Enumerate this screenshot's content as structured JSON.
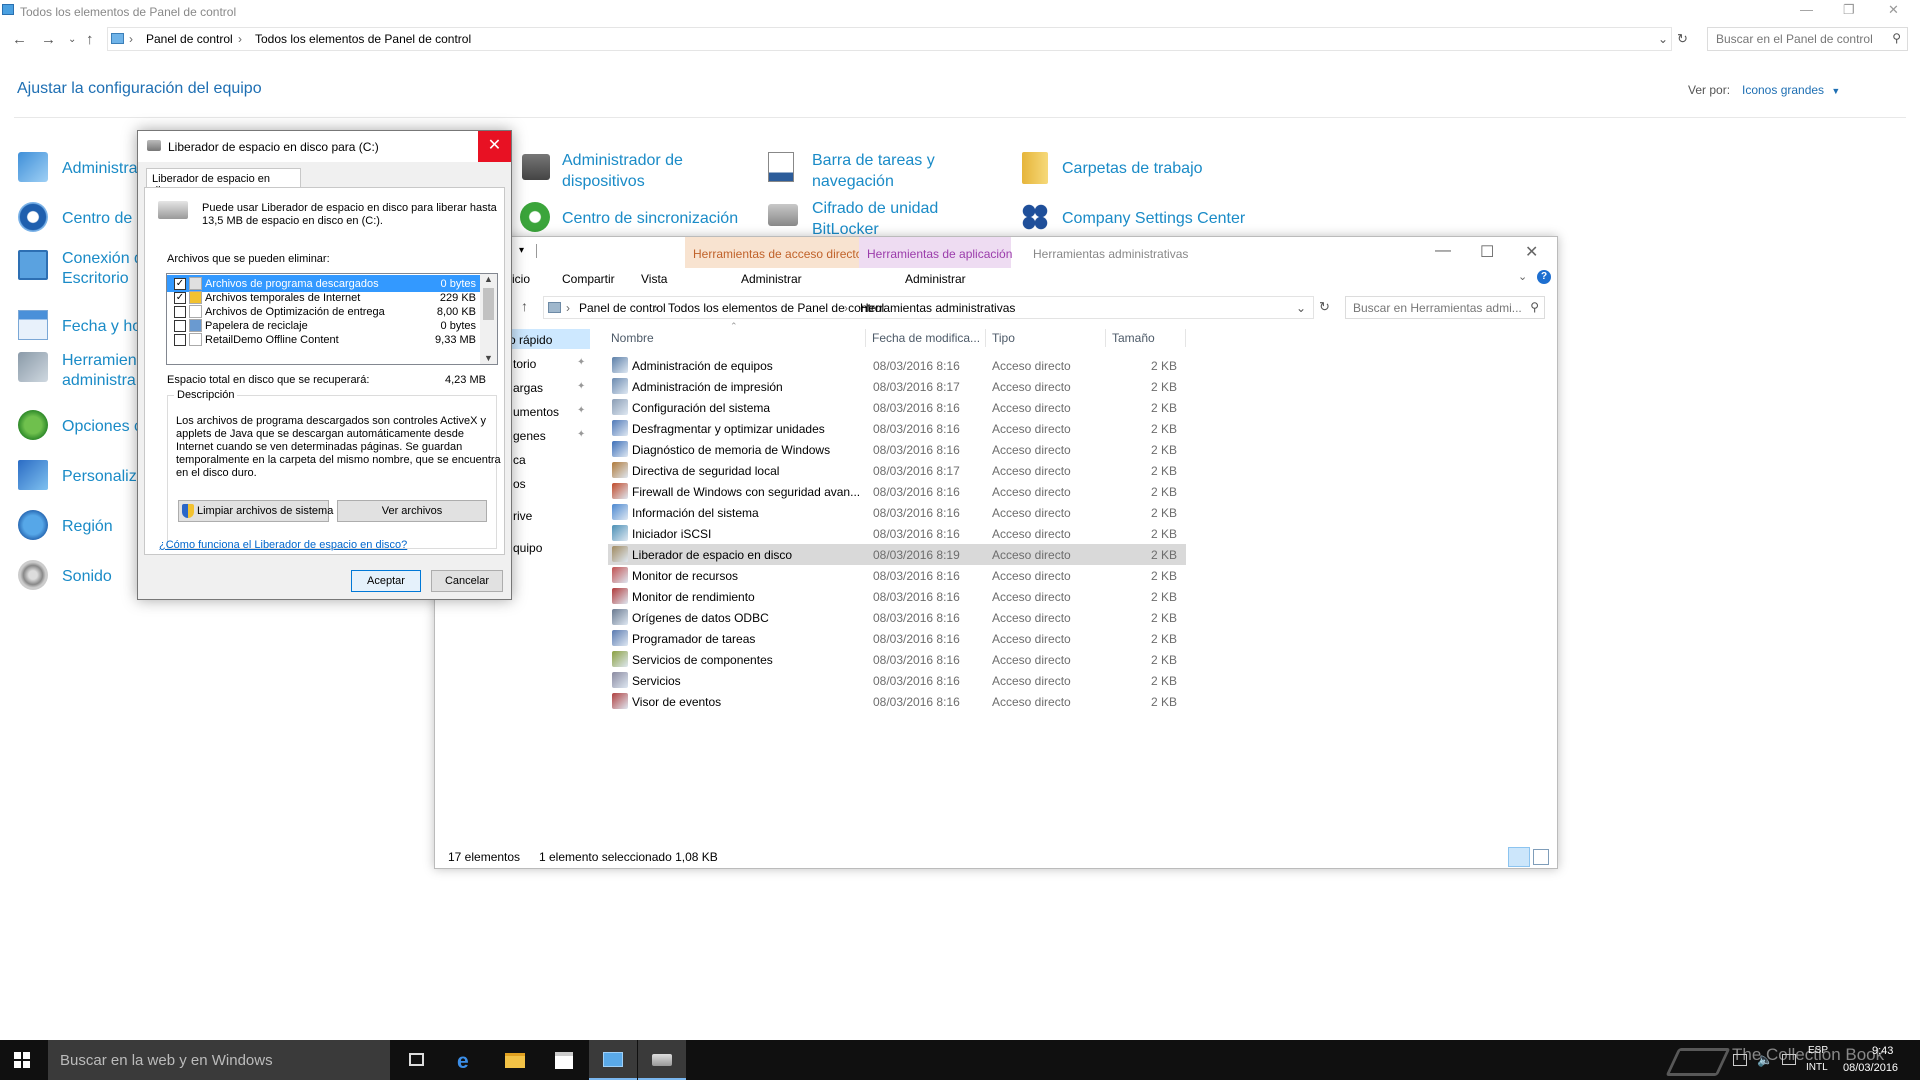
{
  "control_panel": {
    "window_title": "Todos los elementos de Panel de control",
    "breadcrumb": [
      "Panel de control",
      "Todos los elementos de Panel de control"
    ],
    "search_placeholder": "Buscar en el Panel de control",
    "heading": "Ajustar la configuración del equipo",
    "view_by_label": "Ver por:",
    "view_by_value": "Iconos grandes",
    "items_col1": [
      {
        "line1": "Administra",
        "line2": ""
      },
      {
        "line1": "Centro de a",
        "line2": ""
      },
      {
        "line1": "Conexión d",
        "line2": "Escritorio"
      },
      {
        "line1": "Fecha y ho",
        "line2": ""
      },
      {
        "line1": "Herramien",
        "line2": "administra"
      },
      {
        "line1": "Opciones c",
        "line2": ""
      },
      {
        "line1": "Personaliza",
        "line2": ""
      },
      {
        "line1": "Región",
        "line2": ""
      },
      {
        "line1": "Sonido",
        "line2": ""
      }
    ],
    "items_col2": [
      {
        "line1": "Administrador de",
        "line2": "dispositivos"
      },
      {
        "line1": "Centro de sincronización",
        "line2": ""
      }
    ],
    "items_col3": [
      {
        "line1": "Barra de tareas y",
        "line2": "navegación"
      },
      {
        "line1": "Cifrado de unidad",
        "line2": "BitLocker"
      }
    ],
    "items_col4": [
      {
        "line1": "Carpetas de trabajo",
        "line2": ""
      },
      {
        "line1": "Company Settings Center",
        "line2": ""
      }
    ]
  },
  "explorer": {
    "context_tabs": [
      "Herramientas de acceso directo",
      "Herramientas de aplicación"
    ],
    "window_title": "Herramientas administrativas",
    "ribbon": {
      "inicio": "icio",
      "compartir": "Compartir",
      "vista": "Vista",
      "administrar1": "Administrar",
      "administrar2": "Administrar"
    },
    "breadcrumb": [
      "Panel de control",
      "Todos los elementos de Panel de control",
      "Herramientas administrativas"
    ],
    "search_placeholder": "Buscar en Herramientas admi...",
    "nav": [
      "o rápido",
      "torio",
      "argas",
      "umentos",
      "genes",
      "ca",
      "os",
      "rive",
      "quipo"
    ],
    "columns": [
      "Nombre",
      "Fecha de modifica...",
      "Tipo",
      "Tamaño"
    ],
    "files": [
      {
        "name": "Administración de equipos",
        "date": "08/03/2016 8:16",
        "type": "Acceso directo",
        "size": "2 KB"
      },
      {
        "name": "Administración de impresión",
        "date": "08/03/2016 8:17",
        "type": "Acceso directo",
        "size": "2 KB"
      },
      {
        "name": "Configuración del sistema",
        "date": "08/03/2016 8:16",
        "type": "Acceso directo",
        "size": "2 KB"
      },
      {
        "name": "Desfragmentar y optimizar unidades",
        "date": "08/03/2016 8:16",
        "type": "Acceso directo",
        "size": "2 KB"
      },
      {
        "name": "Diagnóstico de memoria de Windows",
        "date": "08/03/2016 8:16",
        "type": "Acceso directo",
        "size": "2 KB"
      },
      {
        "name": "Directiva de seguridad local",
        "date": "08/03/2016 8:17",
        "type": "Acceso directo",
        "size": "2 KB"
      },
      {
        "name": "Firewall de Windows con seguridad avan...",
        "date": "08/03/2016 8:16",
        "type": "Acceso directo",
        "size": "2 KB"
      },
      {
        "name": "Información del sistema",
        "date": "08/03/2016 8:16",
        "type": "Acceso directo",
        "size": "2 KB"
      },
      {
        "name": "Iniciador iSCSI",
        "date": "08/03/2016 8:16",
        "type": "Acceso directo",
        "size": "2 KB"
      },
      {
        "name": "Liberador de espacio en disco",
        "date": "08/03/2016 8:19",
        "type": "Acceso directo",
        "size": "2 KB"
      },
      {
        "name": "Monitor de recursos",
        "date": "08/03/2016 8:16",
        "type": "Acceso directo",
        "size": "2 KB"
      },
      {
        "name": "Monitor de rendimiento",
        "date": "08/03/2016 8:16",
        "type": "Acceso directo",
        "size": "2 KB"
      },
      {
        "name": "Orígenes de datos ODBC",
        "date": "08/03/2016 8:16",
        "type": "Acceso directo",
        "size": "2 KB"
      },
      {
        "name": "Programador de tareas",
        "date": "08/03/2016 8:16",
        "type": "Acceso directo",
        "size": "2 KB"
      },
      {
        "name": "Servicios de componentes",
        "date": "08/03/2016 8:16",
        "type": "Acceso directo",
        "size": "2 KB"
      },
      {
        "name": "Servicios",
        "date": "08/03/2016 8:16",
        "type": "Acceso directo",
        "size": "2 KB"
      },
      {
        "name": "Visor de eventos",
        "date": "08/03/2016 8:16",
        "type": "Acceso directo",
        "size": "2 KB"
      }
    ],
    "selected_index": 9,
    "status_count": "17 elementos",
    "status_selection": "1 elemento seleccionado  1,08 KB"
  },
  "dialog": {
    "title": "Liberador de espacio en disco para  (C:)",
    "tab": "Liberador de espacio en disco",
    "intro_line1": "Puede usar Liberador de espacio en disco para liberar hasta",
    "intro_line2": "13,5 MB de espacio en disco en  (C:).",
    "files_label": "Archivos que se pueden eliminar:",
    "items": [
      {
        "name": "Archivos de programa descargados",
        "size": "0 bytes",
        "checked": true,
        "selected": true
      },
      {
        "name": "Archivos temporales de Internet",
        "size": "229 KB",
        "checked": true,
        "selected": false
      },
      {
        "name": "Archivos de Optimización de entrega",
        "size": "8,00 KB",
        "checked": false,
        "selected": false
      },
      {
        "name": "Papelera de reciclaje",
        "size": "0 bytes",
        "checked": false,
        "selected": false
      },
      {
        "name": "RetailDemo Offline Content",
        "size": "9,33 MB",
        "checked": false,
        "selected": false
      }
    ],
    "total_label": "Espacio total en disco que se recuperará:",
    "total_value": "4,23 MB",
    "description_label": "Descripción",
    "description_lines": [
      "Los archivos de programa descargados son controles ActiveX y",
      "applets de Java que se descargan automáticamente desde",
      "Internet cuando se ven determinadas páginas. Se guardan",
      "temporalmente en la carpeta del mismo nombre, que se encuentra",
      "en el disco duro."
    ],
    "clean_system_button": "Limpiar archivos de sistema",
    "view_files_button": "Ver archivos",
    "help_link": "¿Cómo funciona el Liberador de espacio en disco?",
    "ok_button": "Aceptar",
    "cancel_button": "Cancelar"
  },
  "taskbar": {
    "search_placeholder": "Buscar en la web y en Windows",
    "language": "ESP",
    "layout": "INTL",
    "time": "9:43",
    "date": "08/03/2016",
    "watermark": "The Collection Book"
  }
}
